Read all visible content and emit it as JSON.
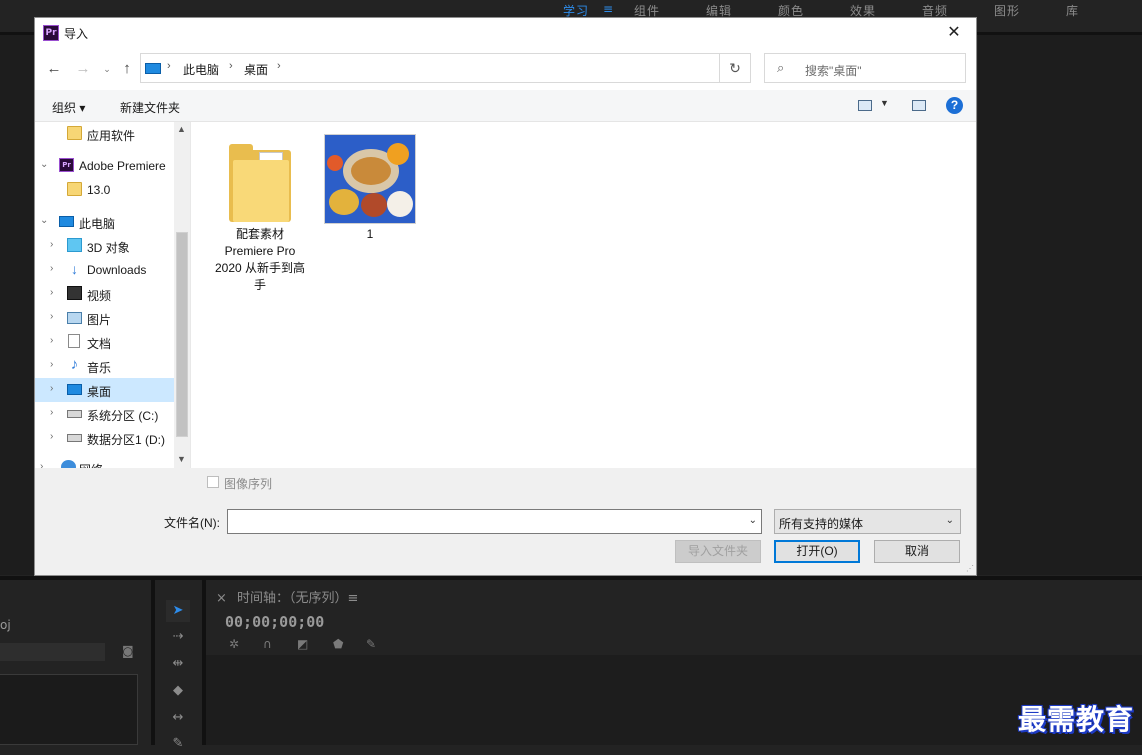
{
  "app": {
    "workspace_tabs": [
      {
        "label": "学习",
        "active": true
      },
      {
        "label": "组件",
        "active": false
      },
      {
        "label": "编辑",
        "active": false
      },
      {
        "label": "颜色",
        "active": false
      },
      {
        "label": "效果",
        "active": false
      },
      {
        "label": "音频",
        "active": false
      },
      {
        "label": "图形",
        "active": false
      },
      {
        "label": "库",
        "active": false
      }
    ],
    "workspace_menu_glyph": "≡",
    "accent_color": "#2d8ceb"
  },
  "dialog": {
    "title": "导入",
    "logo": "Pr",
    "close": "✕",
    "breadcrumb": [
      "此电脑",
      "桌面"
    ],
    "search_placeholder": "搜索\"桌面\"",
    "toolbar": {
      "organize": "组织 ▾",
      "new_folder": "新建文件夹",
      "help": "?"
    },
    "nav_tree": [
      {
        "label": "应用软件",
        "icon": "folder-icon",
        "chevron": ""
      },
      {
        "label": "Adobe Premiere",
        "icon": "premiere-icon",
        "chevron": "⌄"
      },
      {
        "label": "13.0",
        "icon": "folder-icon",
        "chevron": ""
      },
      {
        "label": "此电脑",
        "icon": "pc-icon",
        "chevron": "⌄"
      },
      {
        "label": "3D 对象",
        "icon": "cube-icon",
        "chevron": "›"
      },
      {
        "label": "Downloads",
        "icon": "download-icon",
        "chevron": "›"
      },
      {
        "label": "视频",
        "icon": "video-icon",
        "chevron": "›"
      },
      {
        "label": "图片",
        "icon": "pictures-icon",
        "chevron": "›"
      },
      {
        "label": "文档",
        "icon": "documents-icon",
        "chevron": "›"
      },
      {
        "label": "音乐",
        "icon": "music-icon",
        "chevron": "›"
      },
      {
        "label": "桌面",
        "icon": "desktop-icon",
        "chevron": "›",
        "selected": true
      },
      {
        "label": "系统分区 (C:)",
        "icon": "drive-icon",
        "chevron": "›"
      },
      {
        "label": "数据分区1 (D:)",
        "icon": "drive-icon",
        "chevron": "›"
      },
      {
        "label": "网络",
        "icon": "network-icon",
        "chevron": "›"
      }
    ],
    "files": [
      {
        "name_lines": [
          "配套素材",
          "Premiere Pro",
          "2020 从新手到高",
          "手"
        ],
        "type": "folder"
      },
      {
        "name_lines": [
          "1"
        ],
        "type": "image"
      }
    ],
    "image_sequence_label": "图像序列",
    "filename_label": "文件名(N):",
    "filename_value": "",
    "filter_value": "所有支持的媒体",
    "buttons": {
      "import_folder": "导入文件夹",
      "open": "打开(O)",
      "cancel": "取消"
    }
  },
  "timeline": {
    "header": "时间轴：（无序列）≡",
    "close": "×",
    "timecode": "00;00;00;00"
  },
  "project": {
    "label_fragment": "oj"
  },
  "watermark": "最需教育"
}
